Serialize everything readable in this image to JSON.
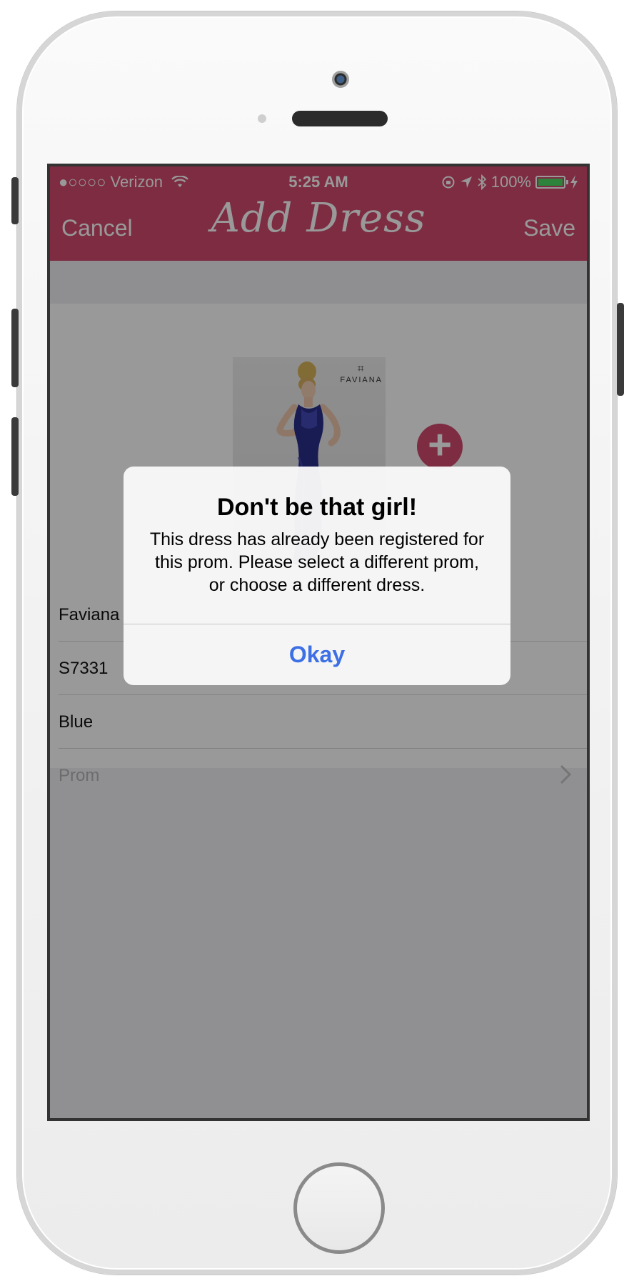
{
  "status_bar": {
    "carrier": "●○○○○ Verizon",
    "time": "5:25 AM",
    "battery": "100%",
    "battery_level": 1.0
  },
  "navbar": {
    "cancel_label": "Cancel",
    "title": "Add Dress",
    "save_label": "Save"
  },
  "dress": {
    "brand_logo": "FAVIANA"
  },
  "form": {
    "brand": "Faviana",
    "style": "S7331",
    "color": "Blue",
    "prom_placeholder": "Prom"
  },
  "alert": {
    "title": "Don't be that girl!",
    "message": "This dress has already been registered for this prom. Please select a different prom, or choose a different dress.",
    "okay_label": "Okay"
  },
  "colors": {
    "brand_pink": "#d14a6f",
    "alert_button_blue": "#3d6fe5",
    "battery_green": "#4cd964"
  }
}
